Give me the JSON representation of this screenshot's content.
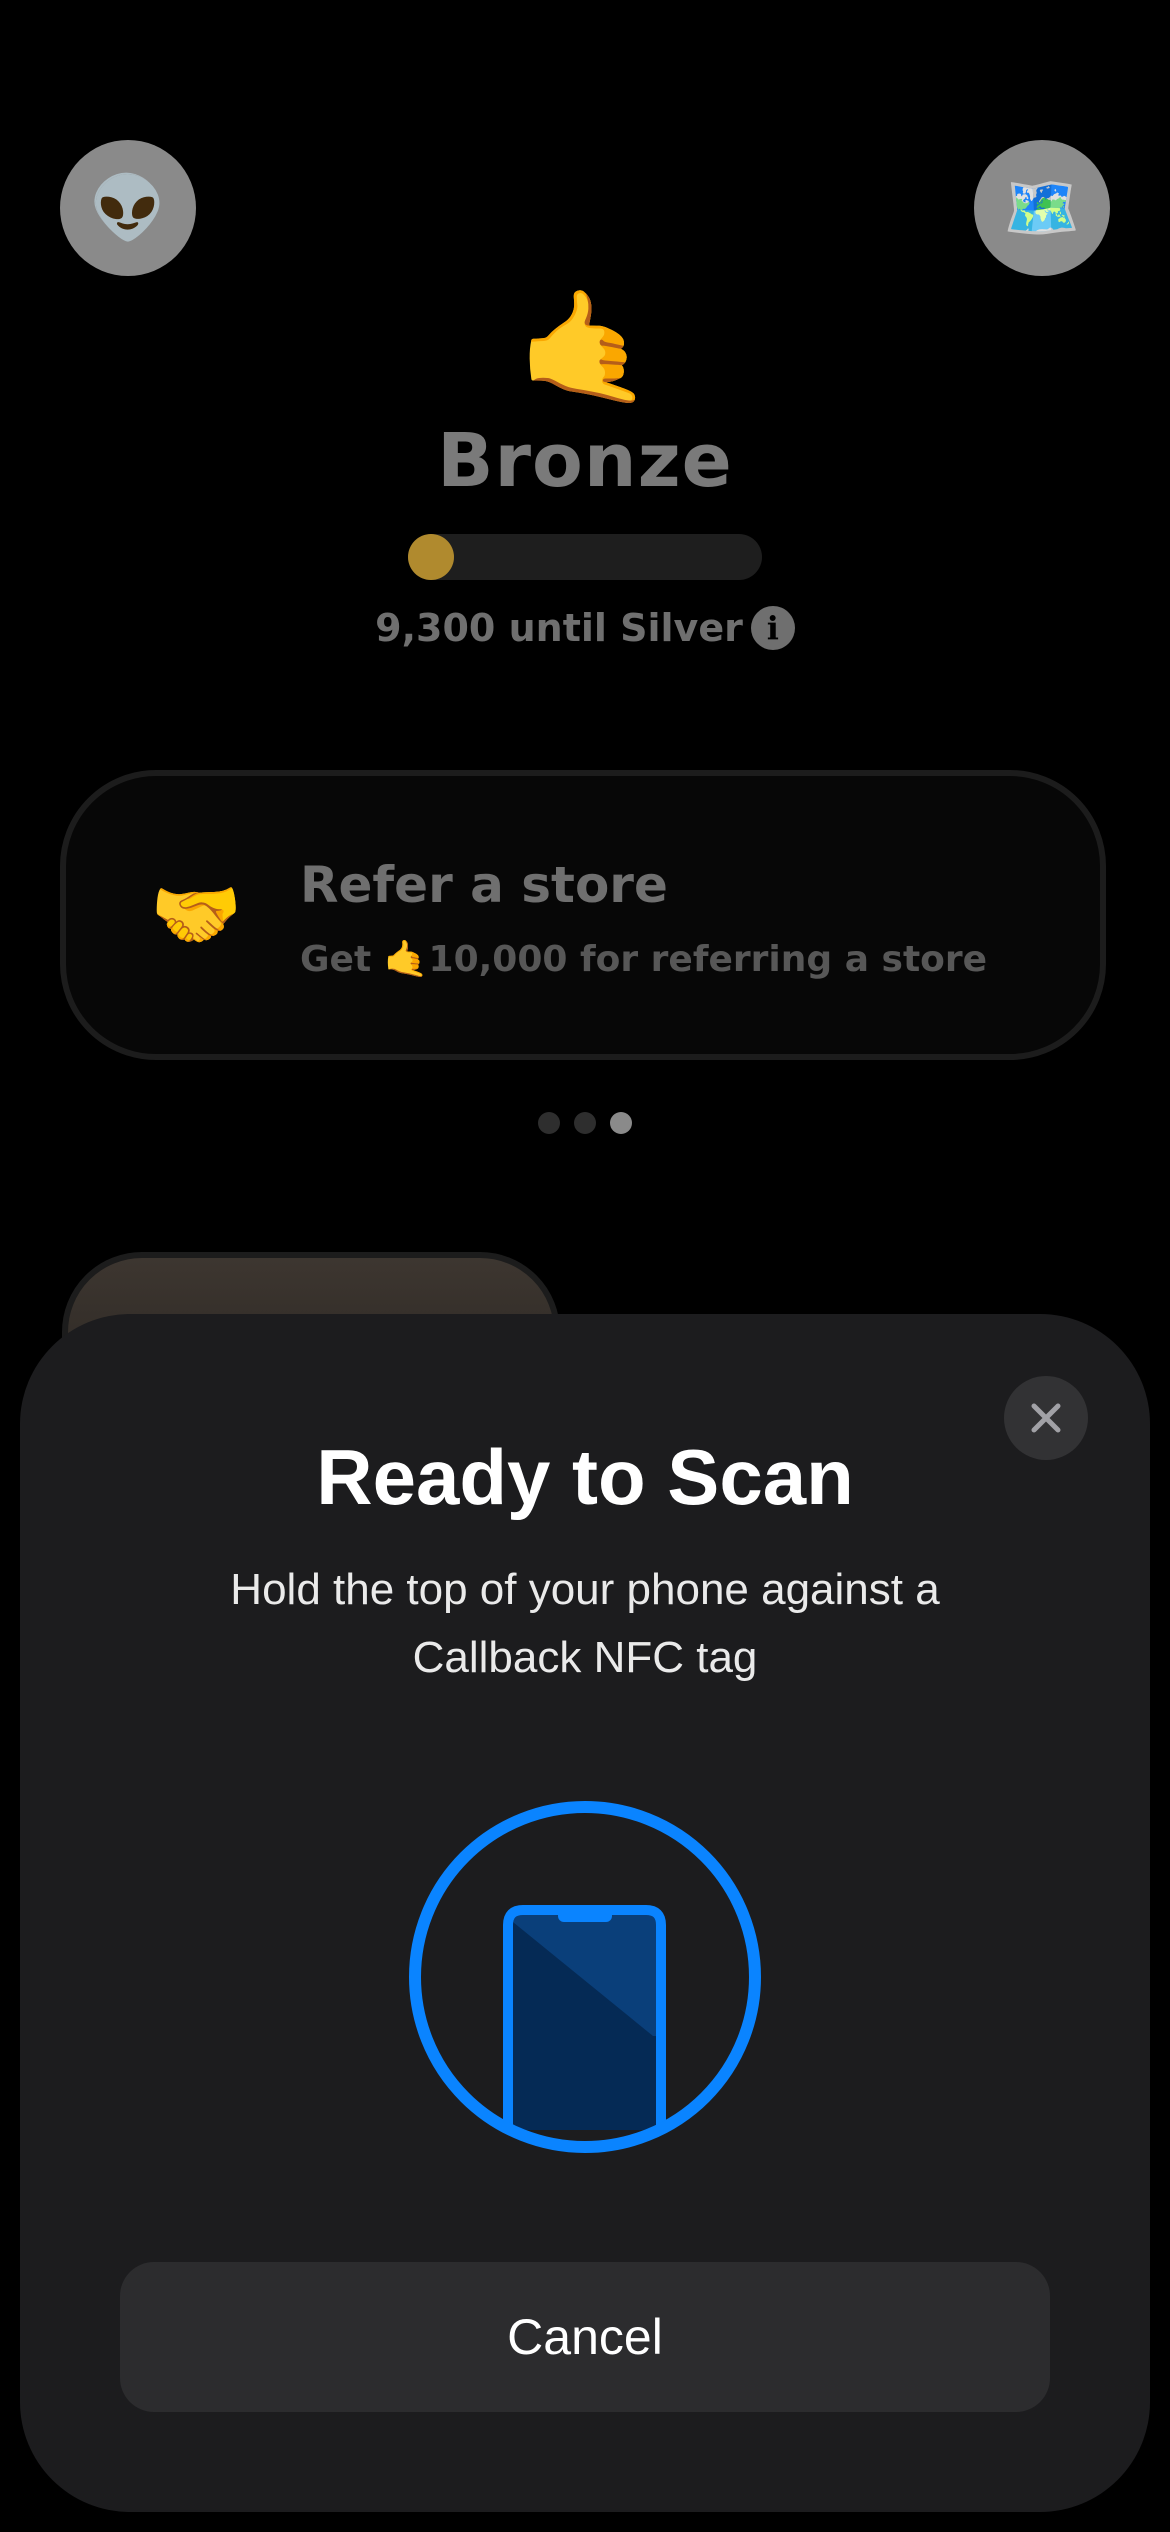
{
  "header": {
    "profile_icon": "alien-emoji-icon",
    "profile_emoji": "👽",
    "map_icon": "world-map-emoji-icon",
    "map_emoji": "🗺️"
  },
  "tier": {
    "emoji": "🤙",
    "name": "Bronze",
    "progress_fraction": 0.08,
    "until_text": "9,300 until Silver",
    "info_symbol": "i"
  },
  "refer_card": {
    "emoji": "🤝",
    "title": "Refer a store",
    "subtitle": "Get 🤙10,000 for referring a store"
  },
  "pager": {
    "count": 3,
    "active_index": 2
  },
  "nfc_sheet": {
    "title": "Ready to Scan",
    "message": "Hold the top of your phone against a Callback NFC tag",
    "cancel_label": "Cancel",
    "close_symbol": "×",
    "accent_color": "#0a84ff"
  }
}
